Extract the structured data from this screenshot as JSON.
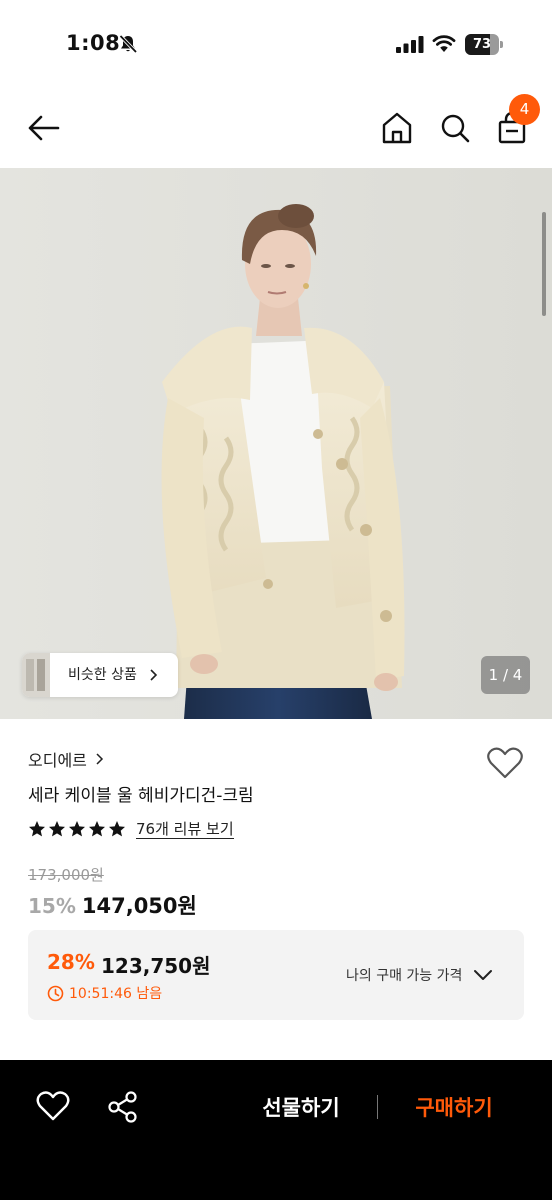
{
  "status_bar": {
    "time": "1:08",
    "battery": "73",
    "battery_level": 0.73
  },
  "header": {
    "cart_count": "4",
    "accent_color": "#ff5a0a"
  },
  "gallery": {
    "similar_label": "비슷한 상품",
    "page_indicator": "1 / 4"
  },
  "product": {
    "brand": "오디에르",
    "title": "세라 케이블 울 헤비가디건-크림",
    "rating_stars": 5,
    "review_link": "76개 리뷰 보기",
    "original_price": "173,000원",
    "discount_rate": "15%",
    "sale_price": "147,050원"
  },
  "my_price": {
    "rate": "28%",
    "price": "123,750원",
    "timer": "10:51:46 남음",
    "label": "나의 구매 가능 가격"
  },
  "bottom_bar": {
    "gift_label": "선물하기",
    "buy_label": "구매하기"
  },
  "icons": [
    "bell-slash-icon",
    "signal-icon",
    "wifi-icon",
    "back-arrow-icon",
    "home-icon",
    "search-icon",
    "shopping-bag-icon",
    "heart-icon",
    "star-icon",
    "clock-icon",
    "chevron-down-icon",
    "share-icon"
  ]
}
